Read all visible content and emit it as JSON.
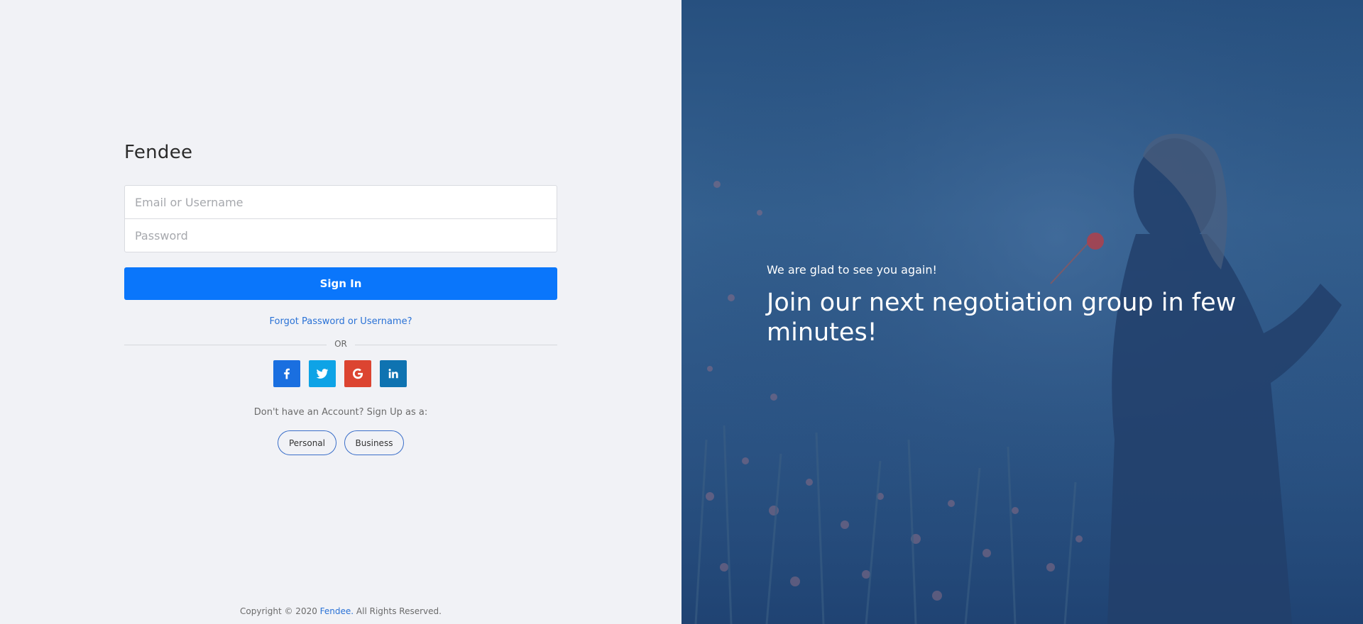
{
  "brand": {
    "name": "Fendee"
  },
  "login": {
    "email_placeholder": "Email or Username",
    "password_placeholder": "Password",
    "signin_label": "Sign In",
    "forgot_label": "Forgot Password or Username?",
    "or_label": "OR"
  },
  "social": [
    {
      "name": "facebook",
      "icon": "facebook-icon",
      "color": "#1a6fe0"
    },
    {
      "name": "twitter",
      "icon": "twitter-icon",
      "color": "#0ea3e6"
    },
    {
      "name": "google",
      "icon": "google-icon",
      "color": "#dc4431"
    },
    {
      "name": "linkedin",
      "icon": "linkedin-icon",
      "color": "#0f73b1"
    }
  ],
  "signup": {
    "prompt": "Don't have an Account? Sign Up as a:",
    "personal_label": "Personal",
    "business_label": "Business"
  },
  "footer": {
    "prefix": "Copyright © 2020 ",
    "brand_link": "Fendee.",
    "suffix": " All Rights Reserved."
  },
  "hero": {
    "tagline": "We are glad to see you again!",
    "headline": "Join our next negotiation group in few minutes!"
  },
  "colors": {
    "accent": "#0a76fb",
    "link": "#2a72d6",
    "left_bg": "#f1f2f6",
    "right_bg": "#2d5686"
  }
}
